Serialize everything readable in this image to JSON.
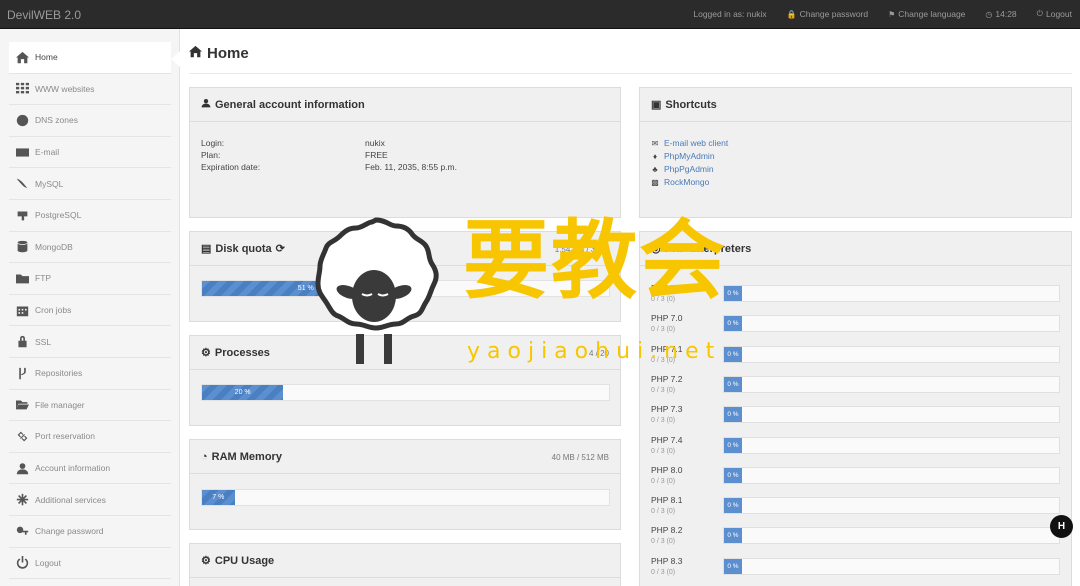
{
  "app": {
    "brand": "DevilWEB 2.0"
  },
  "topnav": {
    "logged_in": "Logged in as: nukix",
    "change_password": "Change password",
    "change_language": "Change language",
    "time": "14:28",
    "logout": "Logout"
  },
  "sidebar": {
    "items": [
      {
        "label": "Home",
        "icon": "home-icon"
      },
      {
        "label": "WWW websites",
        "icon": "grid-icon"
      },
      {
        "label": "DNS zones",
        "icon": "globe-icon"
      },
      {
        "label": "E-mail",
        "icon": "envelope-icon"
      },
      {
        "label": "MySQL",
        "icon": "dolphin-icon"
      },
      {
        "label": "PostgreSQL",
        "icon": "elephant-icon"
      },
      {
        "label": "MongoDB",
        "icon": "database-icon"
      },
      {
        "label": "FTP",
        "icon": "folder-icon"
      },
      {
        "label": "Cron jobs",
        "icon": "calendar-icon"
      },
      {
        "label": "SSL",
        "icon": "lock-icon"
      },
      {
        "label": "Repositories",
        "icon": "branch-icon"
      },
      {
        "label": "File manager",
        "icon": "folder-open-icon"
      },
      {
        "label": "Port reservation",
        "icon": "link-icon"
      },
      {
        "label": "Account information",
        "icon": "user-icon"
      },
      {
        "label": "Additional services",
        "icon": "asterisk-icon"
      },
      {
        "label": "Change password",
        "icon": "key-icon"
      },
      {
        "label": "Logout",
        "icon": "power-icon"
      }
    ]
  },
  "page": {
    "title": "Home"
  },
  "account": {
    "title": "General account information",
    "rows": [
      {
        "label": "Login:",
        "value": "nukix"
      },
      {
        "label": "Plan:",
        "value": "FREE"
      },
      {
        "label": "Expiration date:",
        "value": "Feb. 11, 2035, 8:55 p.m."
      }
    ]
  },
  "disk": {
    "title": "Disk quota",
    "usage": "1.54 GB / 3 GB",
    "percent_label": "51 %",
    "percent": 51
  },
  "processes": {
    "title": "Processes",
    "usage": "4 / 20",
    "percent_label": "20 %",
    "percent": 20
  },
  "ram": {
    "title": "RAM Memory",
    "usage": "40 MB / 512 MB",
    "percent_label": "7 %",
    "percent": 7
  },
  "cpu": {
    "title": "CPU Usage"
  },
  "shortcuts": {
    "title": "Shortcuts",
    "items": [
      {
        "label": "E-mail web client",
        "icon": "envelope-icon"
      },
      {
        "label": "PhpMyAdmin",
        "icon": "dolphin-icon"
      },
      {
        "label": "PhpPgAdmin",
        "icon": "elephant-icon"
      },
      {
        "label": "RockMongo",
        "icon": "database-icon"
      }
    ]
  },
  "php": {
    "title": "PHP interpreters",
    "items": [
      {
        "name": "PHP 5.6",
        "count": "0 / 3 (0)",
        "percent_label": "0 %"
      },
      {
        "name": "PHP 7.0",
        "count": "0 / 3 (0)",
        "percent_label": "0 %"
      },
      {
        "name": "PHP 7.1",
        "count": "0 / 3 (0)",
        "percent_label": "0 %"
      },
      {
        "name": "PHP 7.2",
        "count": "0 / 3 (0)",
        "percent_label": "0 %"
      },
      {
        "name": "PHP 7.3",
        "count": "0 / 3 (0)",
        "percent_label": "0 %"
      },
      {
        "name": "PHP 7.4",
        "count": "0 / 3 (0)",
        "percent_label": "0 %"
      },
      {
        "name": "PHP 8.0",
        "count": "0 / 3 (0)",
        "percent_label": "0 %"
      },
      {
        "name": "PHP 8.1",
        "count": "0 / 3 (0)",
        "percent_label": "0 %"
      },
      {
        "name": "PHP 8.2",
        "count": "0 / 3 (0)",
        "percent_label": "0 %"
      },
      {
        "name": "PHP 8.3",
        "count": "0 / 3 (0)",
        "percent_label": "0 %"
      }
    ]
  },
  "watermark": {
    "text": "要教会",
    "url": "yaojiaohui.net"
  },
  "fab": {
    "label": "H"
  },
  "colors": {
    "accent": "#5b8fd0",
    "link": "#4a79b8",
    "watermark": "#f7c600",
    "topbar": "#2b2b2b"
  }
}
